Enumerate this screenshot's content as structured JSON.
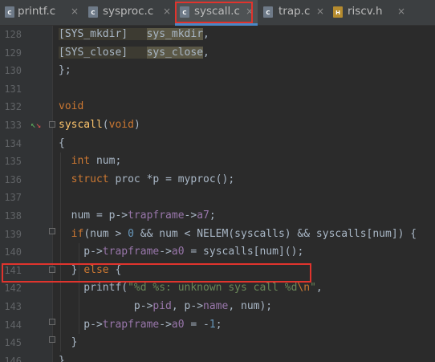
{
  "tabs": [
    {
      "name": "printf.c",
      "icon": "c-file-icon",
      "icon_letter": "C",
      "close": "×",
      "active": false
    },
    {
      "name": "sysproc.c",
      "icon": "c-file-icon",
      "icon_letter": "C",
      "close": "×",
      "active": false
    },
    {
      "name": "syscall.c",
      "icon": "c-file-icon",
      "icon_letter": "C",
      "close": "×",
      "active": true
    },
    {
      "name": "trap.c",
      "icon": "c-file-icon",
      "icon_letter": "C",
      "close": "×",
      "active": false
    },
    {
      "name": "riscv.h",
      "icon": "h-file-icon",
      "icon_letter": "H",
      "close": "×",
      "active": false
    }
  ],
  "colors": {
    "background": "#2b2b2b",
    "keyword": "#cc7832",
    "function": "#ffc66d",
    "field": "#9876aa",
    "number": "#6897bb",
    "string": "#6a8759",
    "highlight_box": "#e0342d"
  },
  "gutter_icon": "implementation-arrow-icon",
  "lines": [
    {
      "num": "128",
      "parts": [
        {
          "t": "[SYS_mkdir]   ",
          "c": "hlm"
        },
        {
          "t": "sys_mkdir",
          "c": "hl"
        },
        {
          "t": ",",
          "c": ""
        }
      ]
    },
    {
      "num": "129",
      "parts": [
        {
          "t": "[SYS_close]   ",
          "c": "hlm"
        },
        {
          "t": "sys_close",
          "c": "hl"
        },
        {
          "t": ",",
          "c": ""
        }
      ]
    },
    {
      "num": "130",
      "parts": [
        {
          "t": "};",
          "c": ""
        }
      ]
    },
    {
      "num": "131",
      "parts": []
    },
    {
      "num": "132",
      "parts": [
        {
          "t": "void",
          "c": "kw"
        }
      ]
    },
    {
      "num": "133",
      "parts": [
        {
          "t": "syscall",
          "c": "fn"
        },
        {
          "t": "(",
          "c": ""
        },
        {
          "t": "void",
          "c": "kw"
        },
        {
          "t": ")",
          "c": ""
        }
      ]
    },
    {
      "num": "134",
      "parts": [
        {
          "t": "{",
          "c": ""
        }
      ]
    },
    {
      "num": "135",
      "parts": [
        {
          "t": "  ",
          "c": ""
        },
        {
          "t": "int",
          "c": "kw"
        },
        {
          "t": " num;",
          "c": ""
        }
      ]
    },
    {
      "num": "136",
      "parts": [
        {
          "t": "  ",
          "c": ""
        },
        {
          "t": "struct",
          "c": "kw"
        },
        {
          "t": " proc *p = myproc();",
          "c": ""
        }
      ]
    },
    {
      "num": "137",
      "parts": []
    },
    {
      "num": "138",
      "parts": [
        {
          "t": "  num = p->",
          "c": ""
        },
        {
          "t": "trapframe",
          "c": "fld"
        },
        {
          "t": "->",
          "c": ""
        },
        {
          "t": "a7",
          "c": "fld"
        },
        {
          "t": ";",
          "c": ""
        }
      ]
    },
    {
      "num": "139",
      "parts": [
        {
          "t": "  ",
          "c": ""
        },
        {
          "t": "if",
          "c": "kw"
        },
        {
          "t": "(num > ",
          "c": ""
        },
        {
          "t": "0",
          "c": "num"
        },
        {
          "t": " && num < NELEM(syscalls) && syscalls[num]) {",
          "c": ""
        }
      ]
    },
    {
      "num": "140",
      "parts": [
        {
          "t": "    p->",
          "c": ""
        },
        {
          "t": "trapframe",
          "c": "fld"
        },
        {
          "t": "->",
          "c": ""
        },
        {
          "t": "a0",
          "c": "fld"
        },
        {
          "t": " = syscalls[num]();",
          "c": ""
        }
      ]
    },
    {
      "num": "141",
      "parts": [
        {
          "t": "  } ",
          "c": ""
        },
        {
          "t": "else",
          "c": "kw"
        },
        {
          "t": " {",
          "c": ""
        }
      ]
    },
    {
      "num": "142",
      "parts": [
        {
          "t": "    printf(",
          "c": ""
        },
        {
          "t": "\"%d %s: unknown sys call %d",
          "c": "str"
        },
        {
          "t": "\\n",
          "c": "esc"
        },
        {
          "t": "\"",
          "c": "str"
        },
        {
          "t": ",",
          "c": ""
        }
      ]
    },
    {
      "num": "143",
      "parts": [
        {
          "t": "            p->",
          "c": ""
        },
        {
          "t": "pid",
          "c": "fld"
        },
        {
          "t": ", p->",
          "c": ""
        },
        {
          "t": "name",
          "c": "fld"
        },
        {
          "t": ", num);",
          "c": ""
        }
      ]
    },
    {
      "num": "144",
      "parts": [
        {
          "t": "    p->",
          "c": ""
        },
        {
          "t": "trapframe",
          "c": "fld"
        },
        {
          "t": "->",
          "c": ""
        },
        {
          "t": "a0",
          "c": "fld"
        },
        {
          "t": " = -",
          "c": ""
        },
        {
          "t": "1",
          "c": "num"
        },
        {
          "t": ";",
          "c": ""
        }
      ]
    },
    {
      "num": "145",
      "parts": [
        {
          "t": "  }",
          "c": ""
        }
      ]
    },
    {
      "num": "146",
      "parts": [
        {
          "t": "}",
          "c": ""
        }
      ]
    }
  ]
}
